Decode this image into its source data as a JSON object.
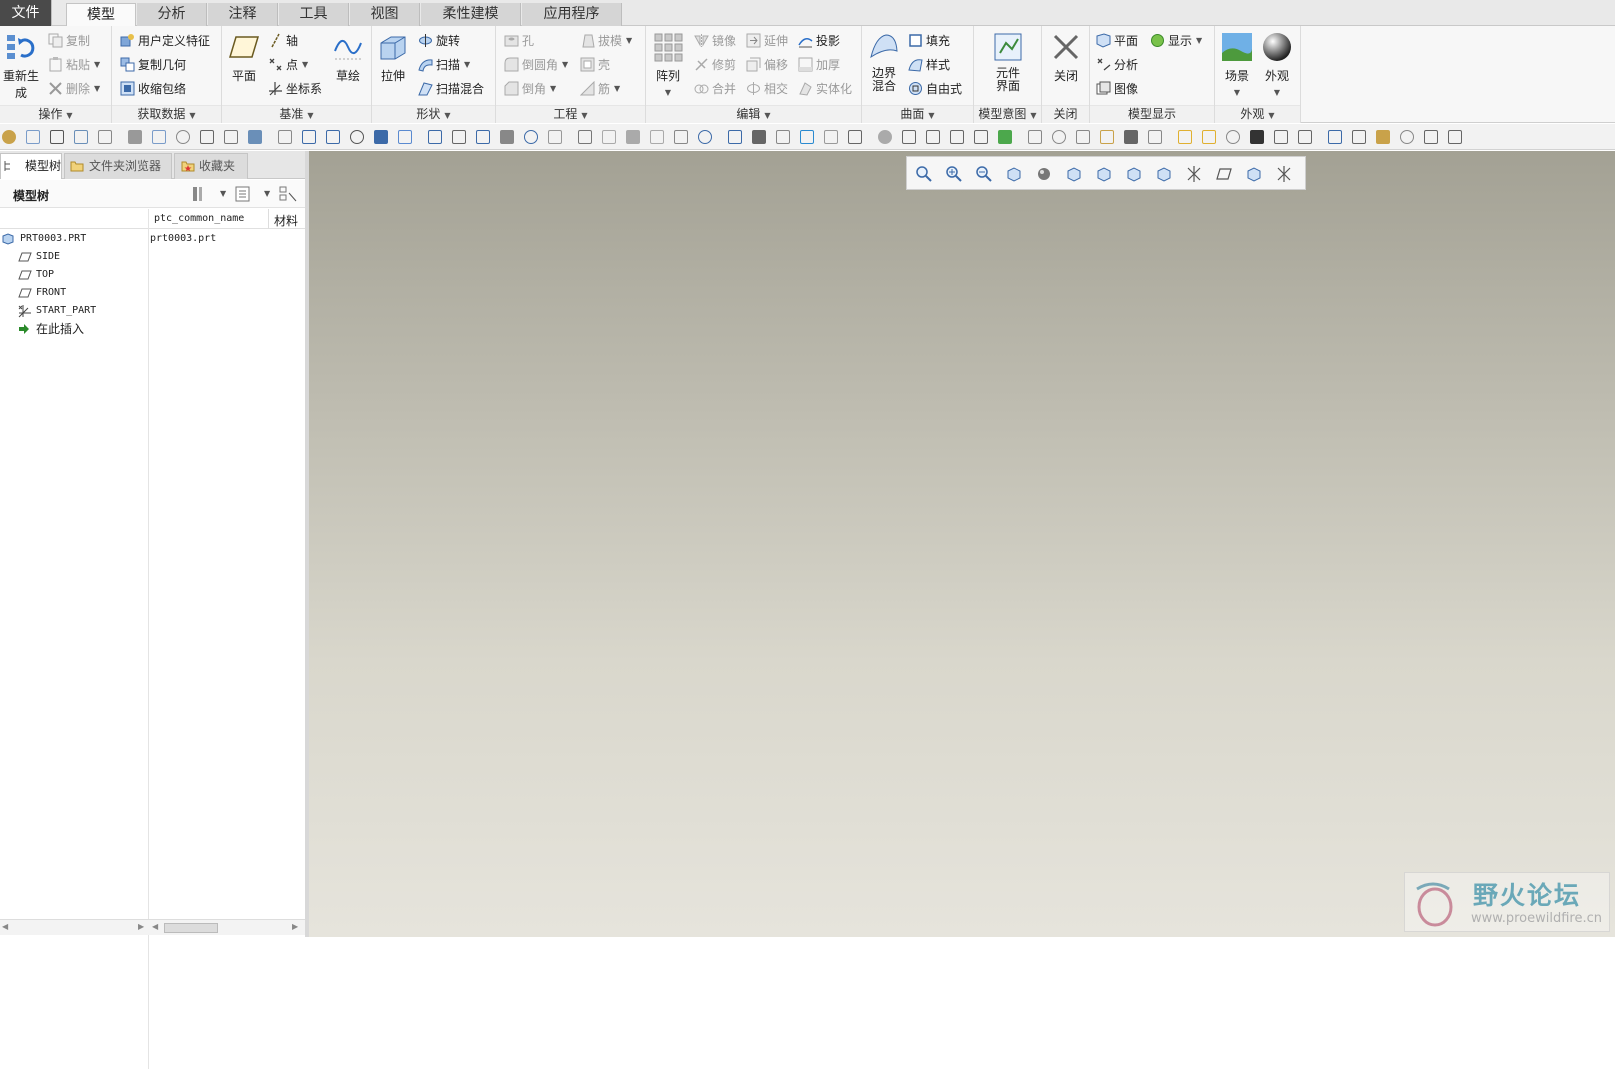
{
  "tabs": [
    "文件",
    "模型",
    "分析",
    "注释",
    "工具",
    "视图",
    "柔性建模",
    "应用程序"
  ],
  "ribbon": {
    "ops": {
      "regen": "重新生成",
      "copy": "复制",
      "paste": "粘贴",
      "delete": "删除",
      "label": "操作"
    },
    "getdata": {
      "udf": "用户定义特征",
      "copygeom": "复制几何",
      "shrink": "收缩包络",
      "label": "获取数据"
    },
    "datum": {
      "plane": "平面",
      "axis": "轴",
      "point": "点",
      "csys": "坐标系",
      "sketch": "草绘",
      "label": "基准"
    },
    "shape": {
      "extrude": "拉伸",
      "revolve": "旋转",
      "sweep": "扫描",
      "sweepblend": "扫描混合",
      "label": "形状"
    },
    "eng": {
      "hole": "孔",
      "draft": "拔模",
      "round": "倒圆角",
      "shell": "壳",
      "chamfer": "倒角",
      "rib": "筋",
      "label": "工程"
    },
    "edit": {
      "pattern": "阵列",
      "mirror": "镜像",
      "extend": "延伸",
      "project": "投影",
      "trim": "修剪",
      "offset": "偏移",
      "thicken": "加厚",
      "merge": "合并",
      "intersect": "相交",
      "solidify": "实体化",
      "label": "编辑"
    },
    "surface": {
      "boundary": "边界混合",
      "fill": "填充",
      "style": "样式",
      "freestyle": "自由式",
      "label": "曲面"
    },
    "intent": {
      "component": "元件界面",
      "label": "模型意图"
    },
    "close": {
      "close": "关闭",
      "label": "关闭"
    },
    "display": {
      "plane": "平面",
      "show": "显示",
      "analysis": "分析",
      "image": "图像",
      "label": "模型显示"
    },
    "appear": {
      "scene": "场景",
      "appearance": "外观",
      "label": "外观"
    }
  },
  "panel": {
    "tabs": [
      "模型树",
      "文件夹浏览器",
      "收藏夹"
    ],
    "title": "模型树",
    "columns": [
      "ptc_common_name",
      "材料"
    ],
    "tree": [
      {
        "name": "PRT0003.PRT",
        "value": "prt0003.prt",
        "icon": "part-icon"
      },
      {
        "name": "SIDE",
        "value": "",
        "icon": "datum-plane-icon"
      },
      {
        "name": "TOP",
        "value": "",
        "icon": "datum-plane-icon"
      },
      {
        "name": "FRONT",
        "value": "",
        "icon": "datum-plane-icon"
      },
      {
        "name": "START_PART",
        "value": "",
        "icon": "csys-icon"
      },
      {
        "name": "在此插入",
        "value": "",
        "icon": "insert-arrow-icon"
      }
    ]
  },
  "watermark": {
    "title": "野火论坛",
    "url": "www.proewildfire.cn"
  }
}
